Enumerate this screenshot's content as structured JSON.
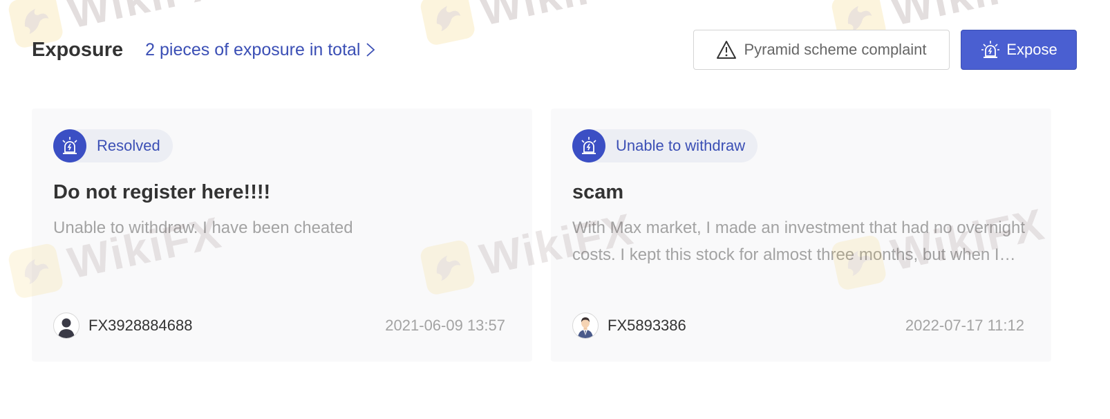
{
  "header": {
    "title": "Exposure",
    "total_link": "2 pieces of exposure in total",
    "complaint_button": "Pyramid scheme complaint",
    "expose_button": "Expose"
  },
  "watermark": {
    "text": "WikiFX"
  },
  "cards": [
    {
      "tag": "Resolved",
      "title": "Do not register here!!!!",
      "body": "Unable to withdraw. I have been cheated",
      "user": "FX3928884688",
      "timestamp": "2021-06-09 13:57",
      "avatar_icon": "default-user-avatar-icon"
    },
    {
      "tag": "Unable to withdraw",
      "title": "scam",
      "body": "With Max market, I made an investment that had no overnight costs. I kept this stock for almost three months, but when I wanted to withdraw, I was told that there were fees.",
      "user": "FX5893386",
      "timestamp": "2022-07-17 11:12",
      "avatar_icon": "businessman-avatar-icon"
    }
  ],
  "colors": {
    "accent": "#3b4fb5",
    "expose_button_bg": "#4a5fd1",
    "tag_bg": "#eceef4",
    "card_bg": "#f8f8f9",
    "muted_text": "#a3a3a3"
  }
}
